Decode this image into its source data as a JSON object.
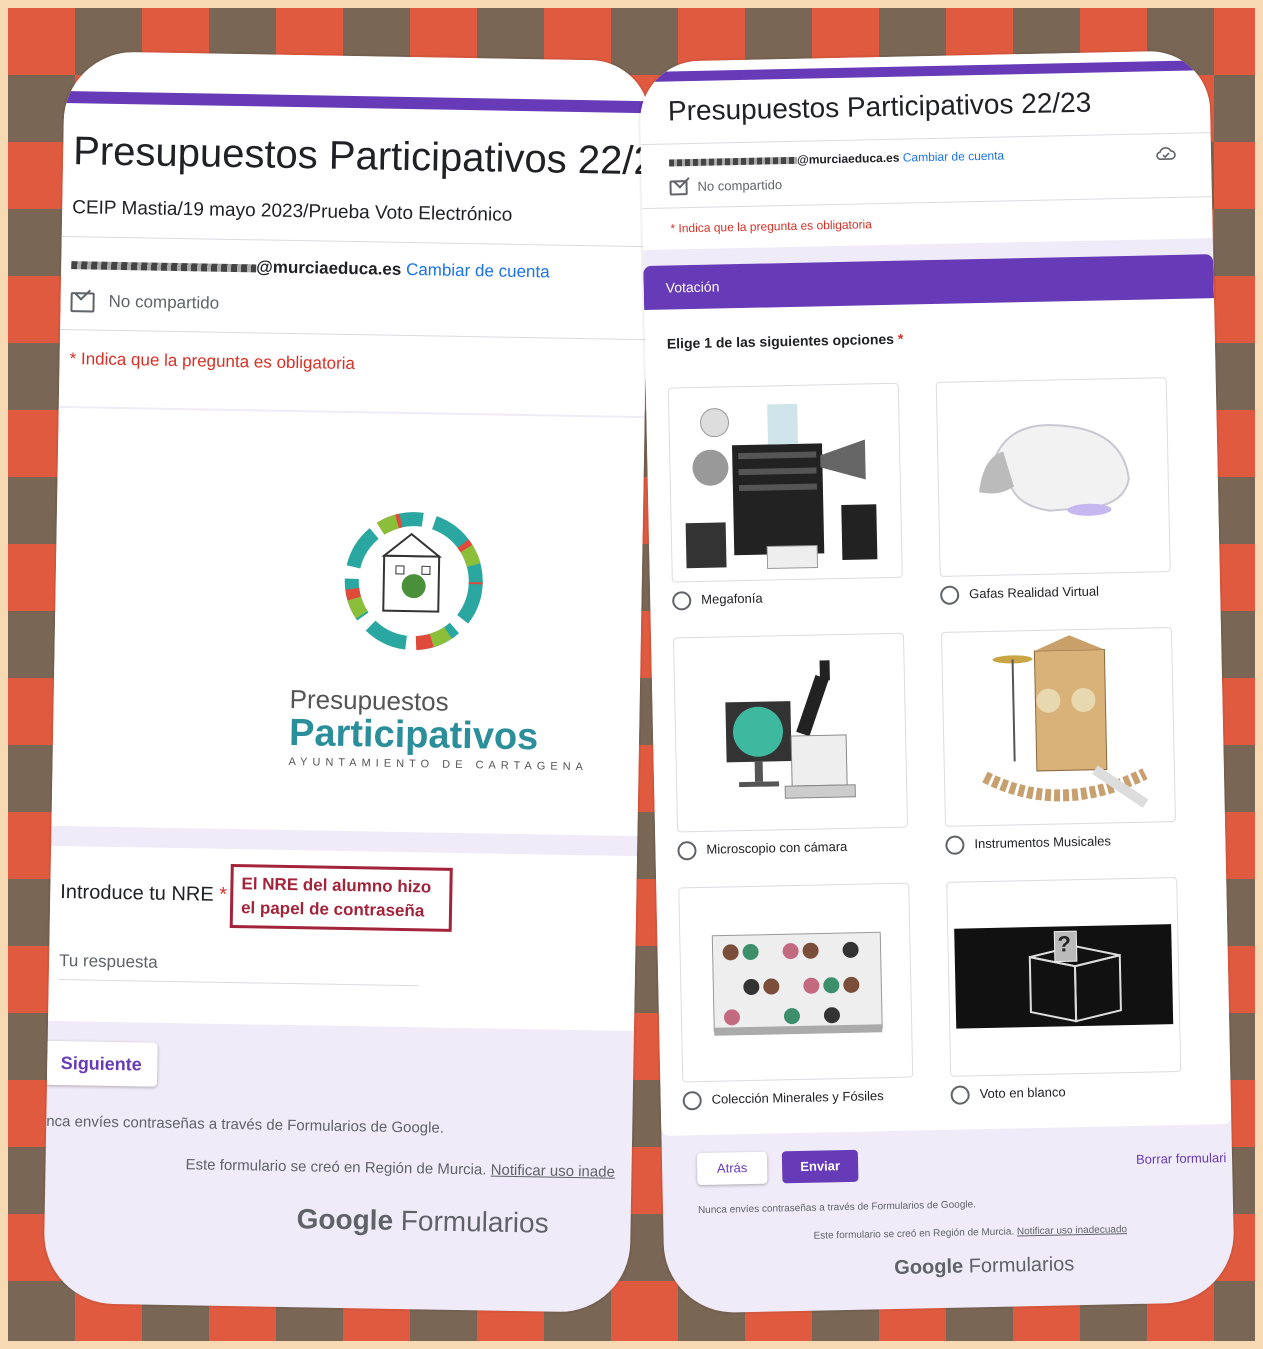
{
  "left": {
    "form_title": "Presupuestos Participativos 22/2",
    "description": "CEIP Mastia/19 mayo 2023/Prueba Voto Electrónico",
    "account_email": "@murciaeduca.es",
    "switch_account": "Cambiar de cuenta",
    "not_shared": "No compartido",
    "required_note": "* Indica que la pregunta es obligatoria",
    "logo": {
      "line1": "Presupuestos",
      "line2": "Participativos",
      "line3": "AYUNTAMIENTO DE CARTAGENA"
    },
    "question_label": "Introduce tu NRE",
    "required_star": "*",
    "annotation": "El NRE del alumno hizo el papel de contraseña",
    "answer_placeholder": "Tu respuesta",
    "next_button": "Siguiente",
    "password_warning": "nca envíes contraseñas a través de Formularios de Google.",
    "created_in": "Este formulario se creó en Región de Murcia.",
    "report_link": "Notificar uso inade",
    "brand_google": "Google",
    "brand_forms": "Formularios"
  },
  "right": {
    "form_title": "Presupuestos Participativos 22/23",
    "account_email": "@murciaeduca.es",
    "switch_account": "Cambiar de cuenta",
    "not_shared": "No compartido",
    "required_note": "* Indica que la pregunta es obligatoria",
    "section_title": "Votación",
    "question": "Elige 1 de las siguientes opciones",
    "required_star": "*",
    "options": [
      {
        "label": "Megafonía",
        "icon": "speaker-icon"
      },
      {
        "label": "Gafas Realidad Virtual",
        "icon": "vr-headset-icon"
      },
      {
        "label": "Microscopio con cámara",
        "icon": "microscope-icon"
      },
      {
        "label": "Instrumentos Musicales",
        "icon": "instruments-icon"
      },
      {
        "label": "Colección Minerales y Fósiles",
        "icon": "minerals-icon"
      },
      {
        "label": "Voto en blanco",
        "icon": "ballot-box-icon"
      }
    ],
    "ballot_mark": "?",
    "back_button": "Atrás",
    "submit_button": "Enviar",
    "clear_button": "Borrar formulari",
    "password_warning": "Nunca envíes contraseñas a través de Formularios de Google.",
    "created_in": "Este formulario se creó en Región de Murcia.",
    "report_link": "Notificar uso inadecuado",
    "brand_google": "Google",
    "brand_forms": "Formularios"
  },
  "colors": {
    "accent": "#673ab7",
    "required": "#d93025",
    "link": "#1a73e8",
    "annotation": "#a3243a"
  }
}
